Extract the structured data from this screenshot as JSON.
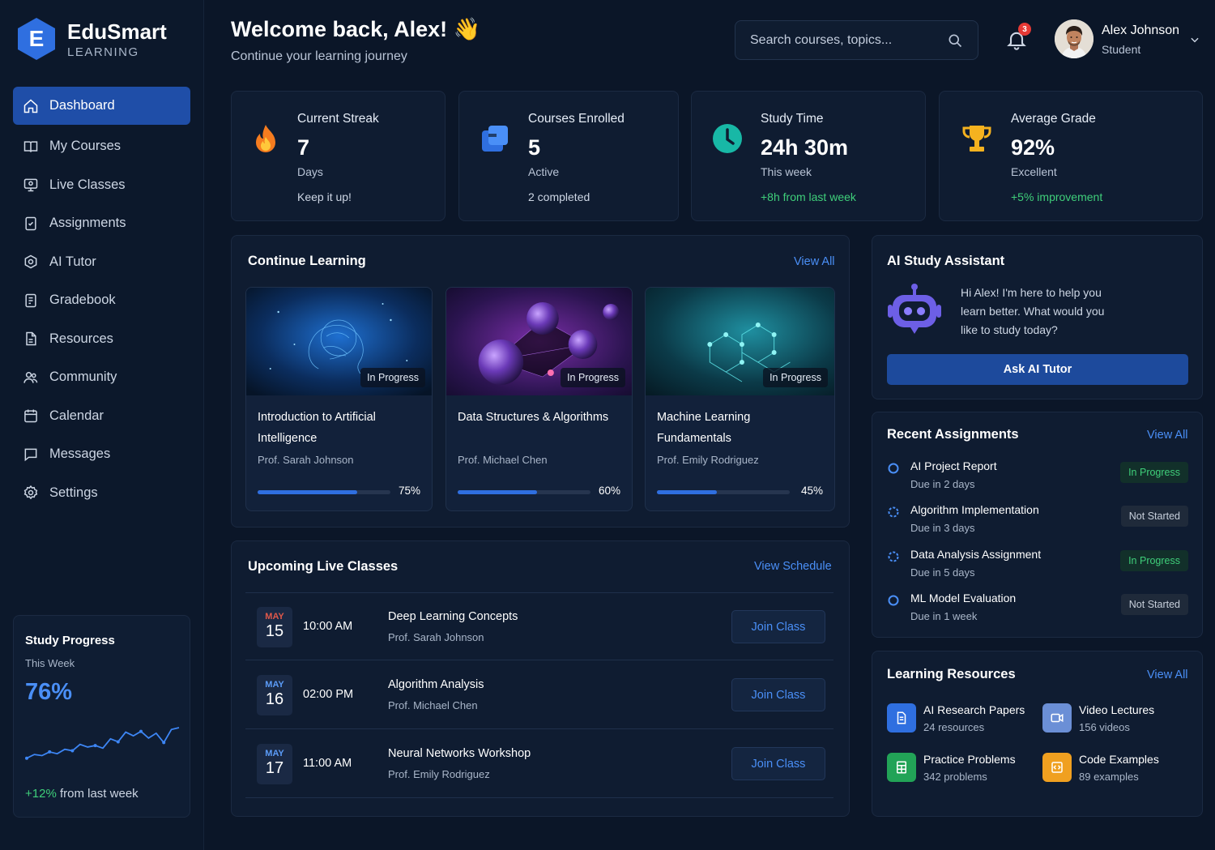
{
  "brand": {
    "name": "EduSmart",
    "sub": "LEARNING",
    "logo_letter": "E"
  },
  "nav": [
    {
      "label": "Dashboard",
      "icon": "home-icon",
      "active": true
    },
    {
      "label": "My Courses",
      "icon": "book-icon"
    },
    {
      "label": "Live Classes",
      "icon": "monitor-icon"
    },
    {
      "label": "Assignments",
      "icon": "clipboard-icon"
    },
    {
      "label": "AI Tutor",
      "icon": "brain-icon"
    },
    {
      "label": "Gradebook",
      "icon": "gradebook-icon"
    },
    {
      "label": "Resources",
      "icon": "file-icon"
    },
    {
      "label": "Community",
      "icon": "users-icon"
    },
    {
      "label": "Calendar",
      "icon": "calendar-icon"
    },
    {
      "label": "Messages",
      "icon": "message-icon"
    },
    {
      "label": "Settings",
      "icon": "gear-icon"
    }
  ],
  "study_progress": {
    "title": "Study Progress",
    "period": "This Week",
    "value": "76%",
    "change": "+12%",
    "change_suffix": " from last week",
    "sparkline": [
      0.18,
      0.28,
      0.25,
      0.35,
      0.3,
      0.42,
      0.38,
      0.55,
      0.48,
      0.52,
      0.45,
      0.7,
      0.62,
      0.88,
      0.78,
      0.9,
      0.72,
      0.85,
      0.6,
      0.95,
      1.0
    ]
  },
  "header": {
    "welcome": "Welcome back, Alex! 👋",
    "subtitle": "Continue your learning journey",
    "search_placeholder": "Search courses, topics...",
    "notifications": "3",
    "user_name": "Alex Johnson",
    "user_role": "Student"
  },
  "stats": [
    {
      "label": "Current Streak",
      "value": "7",
      "unit": "Days",
      "note": "Keep it up!",
      "note_green": false,
      "icon": "flame-icon"
    },
    {
      "label": "Courses Enrolled",
      "value": "5",
      "unit": "Active",
      "note": "2 completed",
      "note_green": false,
      "icon": "courses-icon"
    },
    {
      "label": "Study Time",
      "value": "24h 30m",
      "unit": "This week",
      "note": "+8h from last week",
      "note_green": true,
      "icon": "clock-icon"
    },
    {
      "label": "Average Grade",
      "value": "92%",
      "unit": "Excellent",
      "note": "+5% improvement",
      "note_green": true,
      "icon": "trophy-icon"
    }
  ],
  "continue_learning": {
    "title": "Continue Learning",
    "link": "View All",
    "courses": [
      {
        "tag": "In Progress",
        "title": "Introduction to Artificial Intelligence",
        "prof": "Prof. Sarah Johnson",
        "progress": 0.75,
        "progress_label": "75%"
      },
      {
        "tag": "In Progress",
        "title": "Data Structures & Algorithms",
        "prof": "Prof. Michael Chen",
        "progress": 0.6,
        "progress_label": "60%"
      },
      {
        "tag": "In Progress",
        "title": "Machine Learning Fundamentals",
        "prof": "Prof. Emily Rodriguez",
        "progress": 0.45,
        "progress_label": "45%"
      }
    ]
  },
  "live_classes": {
    "title": "Upcoming Live Classes",
    "link": "View Schedule",
    "items": [
      {
        "month": "MAY",
        "day": "15",
        "time": "10:00 AM",
        "title": "Deep Learning Concepts",
        "prof": "Prof. Sarah Johnson",
        "button": "Join Class",
        "month_color": "#e0584a"
      },
      {
        "month": "MAY",
        "day": "16",
        "time": "02:00 PM",
        "title": "Algorithm Analysis",
        "prof": "Prof. Michael Chen",
        "button": "Join Class",
        "month_color": "#5b9bf7"
      },
      {
        "month": "MAY",
        "day": "17",
        "time": "11:00 AM",
        "title": "Neural Networks Workshop",
        "prof": "Prof. Emily Rodriguez",
        "button": "Join Class",
        "month_color": "#5b9bf7"
      }
    ]
  },
  "ai_assistant": {
    "title": "AI Study Assistant",
    "message": "Hi Alex! I'm here to help you learn better. What would you like to study today?",
    "button": "Ask AI Tutor"
  },
  "assignments": {
    "title": "Recent Assignments",
    "link": "View All",
    "items": [
      {
        "title": "AI Project Report",
        "due": "Due in 2 days",
        "status": "In Progress"
      },
      {
        "title": "Algorithm Implementation",
        "due": "Due in 3 days",
        "status": "Not Started"
      },
      {
        "title": "Data Analysis Assignment",
        "due": "Due in 5 days",
        "status": "In Progress"
      },
      {
        "title": "ML Model Evaluation",
        "due": "Due in 1 week",
        "status": "Not Started"
      }
    ]
  },
  "resources": {
    "title": "Learning Resources",
    "link": "View All",
    "items": [
      {
        "name": "AI Research Papers",
        "count": "24 resources",
        "color": "#2f6fe0",
        "icon": "document-icon"
      },
      {
        "name": "Video Lectures",
        "count": "156 videos",
        "color": "#6b8fd6",
        "icon": "video-icon"
      },
      {
        "name": "Practice Problems",
        "count": "342 problems",
        "color": "#22a357",
        "icon": "spreadsheet-icon"
      },
      {
        "name": "Code Examples",
        "count": "89 examples",
        "color": "#f0a020",
        "icon": "code-icon"
      }
    ]
  },
  "colors": {
    "accent": "#2f6fe0",
    "link": "#4a8ff7",
    "success": "#3fcf7a",
    "background": "#0b1628"
  }
}
